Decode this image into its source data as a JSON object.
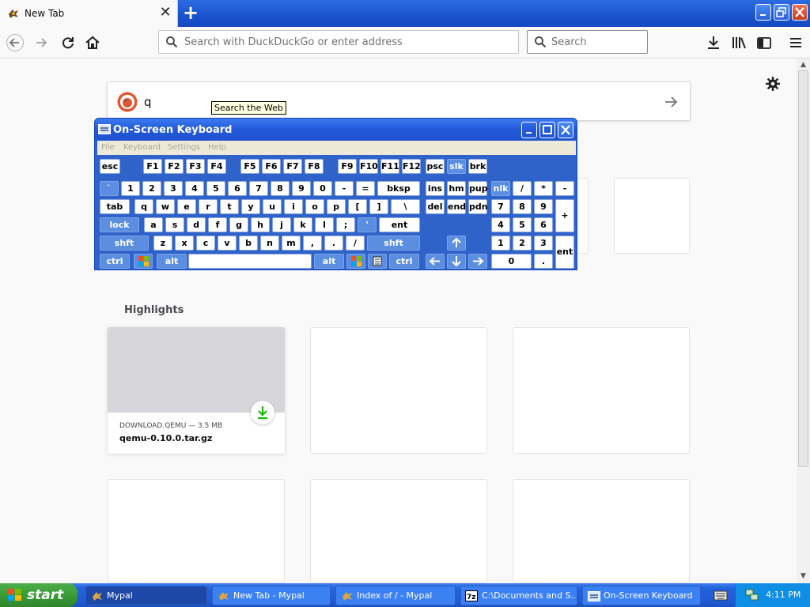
{
  "browser": {
    "tab_title": "New Tab",
    "tab_close": "✕",
    "new_tab": "+",
    "url_placeholder": "Search with DuckDuckGo or enter address",
    "search_placeholder": "Search"
  },
  "page": {
    "ddg_query": "q",
    "tooltip": "Search the Web",
    "highlights_title": "Highlights",
    "card": {
      "source": "DOWNLOAD.QEMU — 3.5 MB",
      "name": "qemu-0.10.0.tar.gz"
    }
  },
  "osk": {
    "title": "On-Screen Keyboard",
    "menu": [
      "File",
      "Keyboard",
      "Settings",
      "Help"
    ],
    "rows": {
      "fn": [
        "esc",
        "F1",
        "F2",
        "F3",
        "F4",
        "F5",
        "F6",
        "F7",
        "F8",
        "F9",
        "F10",
        "F11",
        "F12",
        "psc",
        "slk",
        "brk"
      ],
      "num": [
        "`",
        "1",
        "2",
        "3",
        "4",
        "5",
        "6",
        "7",
        "8",
        "9",
        "0",
        "-",
        "=",
        "bksp",
        "ins",
        "hm",
        "pup",
        "nlk",
        "/",
        "*",
        "-"
      ],
      "top": [
        "tab",
        "q",
        "w",
        "e",
        "r",
        "t",
        "y",
        "u",
        "i",
        "o",
        "p",
        "[",
        "]",
        "\\",
        "del",
        "end",
        "pdn",
        "7",
        "8",
        "9",
        "+"
      ],
      "home": [
        "lock",
        "a",
        "s",
        "d",
        "f",
        "g",
        "h",
        "j",
        "k",
        "l",
        ";",
        "'",
        "ent",
        "4",
        "5",
        "6"
      ],
      "shift": [
        "shft",
        "z",
        "x",
        "c",
        "v",
        "b",
        "n",
        "m",
        ",",
        ".",
        "/",
        "shft",
        "1",
        "2",
        "3",
        "ent"
      ],
      "bottom": [
        "ctrl",
        "alt",
        "alt",
        "ctrl",
        "0",
        "."
      ]
    }
  },
  "taskbar": {
    "start": "start",
    "tasks": [
      "Mypal",
      "New Tab - Mypal",
      "Index of / - Mypal",
      "C:\\Documents and S...",
      "On-Screen Keyboard"
    ],
    "clock": "4:11 PM"
  },
  "colors": {
    "xp_blue": "#2463dc",
    "start_green": "#3a9b38",
    "download_green": "#12bc00"
  }
}
